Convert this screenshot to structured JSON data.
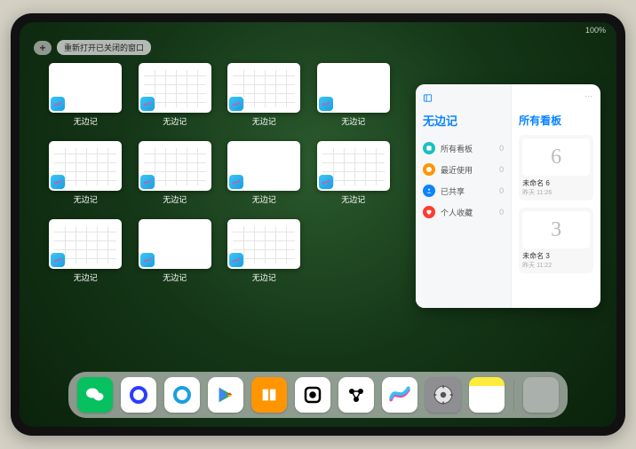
{
  "status": {
    "right": "100%"
  },
  "controls": {
    "add": "+",
    "reopen": "重新打开已关闭的窗口"
  },
  "thumbnails": {
    "label": "无边记",
    "count": 11
  },
  "panel": {
    "edit_indicator": "…",
    "left_title": "无边记",
    "right_title": "所有看板",
    "categories": [
      {
        "label": "所有看板",
        "count": 0,
        "color": "#1ac0c0"
      },
      {
        "label": "最近使用",
        "count": 0,
        "color": "#ff9500"
      },
      {
        "label": "已共享",
        "count": 0,
        "color": "#0a84ff"
      },
      {
        "label": "个人收藏",
        "count": 0,
        "color": "#ff3b30"
      }
    ],
    "boards": [
      {
        "glyph": "6",
        "name": "未命名 6",
        "sub": "昨天 11:26"
      },
      {
        "glyph": "3",
        "name": "未命名 3",
        "sub": "昨天 11:22"
      }
    ]
  },
  "dock": {
    "apps": [
      {
        "name": "wechat",
        "bg": "#07c160",
        "glyph_color": "#fff"
      },
      {
        "name": "quark",
        "bg": "#ffffff",
        "glyph_color": "#2b3cff"
      },
      {
        "name": "qqbrowser",
        "bg": "#ffffff",
        "glyph_color": "#1a9fe0"
      },
      {
        "name": "play",
        "bg": "#ffffff"
      },
      {
        "name": "books",
        "bg": "#ff9500"
      },
      {
        "name": "dice",
        "bg": "#ffffff"
      },
      {
        "name": "atoms",
        "bg": "#ffffff"
      },
      {
        "name": "freeform",
        "bg": "#ffffff"
      },
      {
        "name": "settings",
        "bg": "#8e8e93"
      },
      {
        "name": "notes",
        "bg": "linear-gradient(#ffeb3b 25%, #fff 25%)"
      }
    ]
  }
}
